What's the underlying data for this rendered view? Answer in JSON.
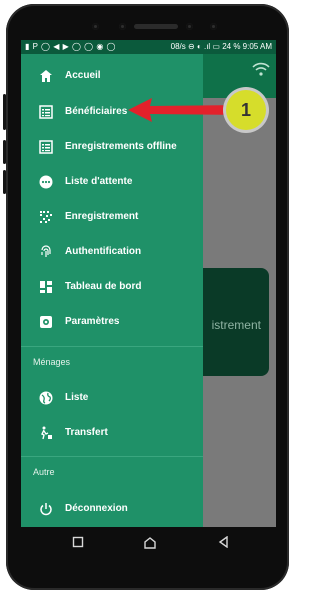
{
  "status_bar": {
    "left_icons": "▮ P ◯ ◀ ▶ ◯ ◯ ◉ ◯",
    "right_text": "08/s ⊖ ◐ .ıl ▭ 24 % 9:05 AM"
  },
  "background_card": {
    "text": "istrement"
  },
  "drawer": {
    "items": [
      {
        "label": "Accueil",
        "icon": "home-icon"
      },
      {
        "label": "Bénéficiaires",
        "icon": "list-icon"
      },
      {
        "label": "Enregistrements offline",
        "icon": "list-icon"
      },
      {
        "label": "Liste d'attente",
        "icon": "more-icon"
      },
      {
        "label": "Enregistrement",
        "icon": "qr-icon"
      },
      {
        "label": "Authentification",
        "icon": "fingerprint-icon"
      },
      {
        "label": "Tableau de bord",
        "icon": "dashboard-icon"
      },
      {
        "label": "Paramètres",
        "icon": "settings-icon"
      }
    ],
    "sections": [
      {
        "title": "Ménages",
        "items": [
          {
            "label": "Liste",
            "icon": "globe-icon"
          },
          {
            "label": "Transfert",
            "icon": "transfer-icon"
          }
        ]
      },
      {
        "title": "Autre",
        "items": [
          {
            "label": "Déconnexion",
            "icon": "power-icon"
          }
        ]
      }
    ]
  },
  "annotation": {
    "number": "1",
    "color": "#d6dd2b",
    "arrow_color": "#e3212b"
  },
  "colors": {
    "drawer": "#1f9168",
    "appbar": "#0f7149",
    "statusbar": "#0b5a3c"
  }
}
